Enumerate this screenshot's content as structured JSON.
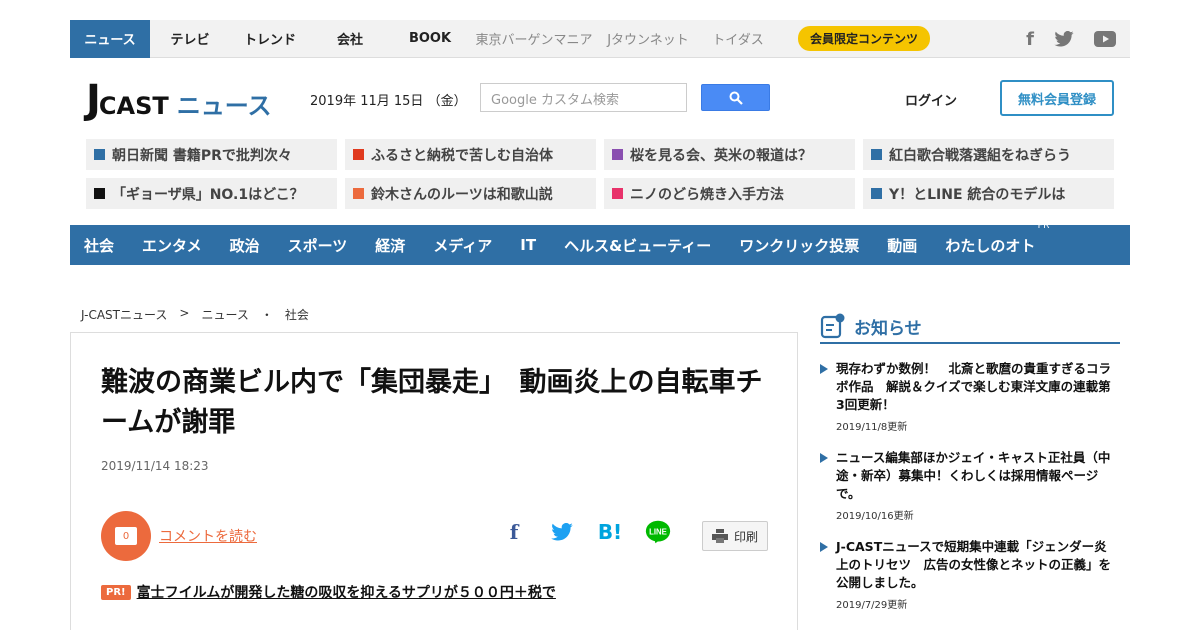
{
  "topnav": {
    "items": [
      "ニュース",
      "テレビ",
      "トレンド",
      "会社",
      "BOOK"
    ],
    "gray_items": [
      "東京バーゲンマニア",
      "Jタウンネット",
      "トイダス"
    ],
    "badge": "会員限定コンテンツ"
  },
  "social": {
    "icons": [
      "facebook-icon",
      "twitter-icon",
      "youtube-icon"
    ]
  },
  "header": {
    "logo_j": "J",
    "logo_cast": "CAST",
    "logo_news": "ニュース",
    "date": "2019年 11月 15日 （金）",
    "search_placeholder": "Google カスタム検索",
    "login": "ログイン",
    "register": "無料会員登録"
  },
  "topics": [
    {
      "label": "朝日新聞 書籍PRで批判次々",
      "color": "#2f6fa5"
    },
    {
      "label": "ふるさと納税で苦しむ自治体",
      "color": "#e03a1e"
    },
    {
      "label": "桜を見る会、英米の報道は？",
      "color": "#8a4fb0"
    },
    {
      "label": "紅白歌合戦落選組をねぎらう",
      "color": "#2f6fa5"
    },
    {
      "label": "「ギョーザ県」NO.1はどこ？",
      "color": "#111111"
    },
    {
      "label": "鈴木さんのルーツは和歌山説",
      "color": "#ec6a3d"
    },
    {
      "label": "ニノのどら焼き入手方法",
      "color": "#e8326a"
    },
    {
      "label": "Y！とLINE 統合のモデルは",
      "color": "#2f6fa5"
    }
  ],
  "categories": [
    "社会",
    "エンタメ",
    "政治",
    "スポーツ",
    "経済",
    "メディア",
    "IT",
    "ヘルス&ビューティー",
    "ワンクリック投票",
    "動画",
    "わたしのオト"
  ],
  "category_pr": "PR",
  "breadcrumb": [
    "J-CASTニュース",
    ">",
    "ニュース",
    "・",
    "社会"
  ],
  "article": {
    "title": "難波の商業ビル内で「集団暴走」　動画炎上の自転車チームが謝罪",
    "date": "2019/11/14 18:23",
    "comment_count": "0",
    "comment_link": "コメントを読む",
    "print": "印刷",
    "pr_badge": "PR!",
    "pr_link": "富士フイルムが開発した糖の吸収を抑えるサプリが５００円＋税で"
  },
  "sidebar": {
    "heading": "お知らせ",
    "notices": [
      {
        "text": "現存わずか数例！　北斎と歌麿の貴重すぎるコラボ作品　解説＆クイズで楽しむ東洋文庫の連載第3回更新！",
        "date": "2019/11/8更新"
      },
      {
        "text": "ニュース編集部ほかジェイ・キャスト正社員（中途・新卒）募集中！くわしくは採用情報ページで。",
        "date": "2019/10/16更新"
      },
      {
        "text": "J-CASTニュースで短期集中連載「ジェンダー炎上のトリセツ　広告の女性像とネットの正義」を公開しました。",
        "date": "2019/7/29更新"
      }
    ]
  }
}
